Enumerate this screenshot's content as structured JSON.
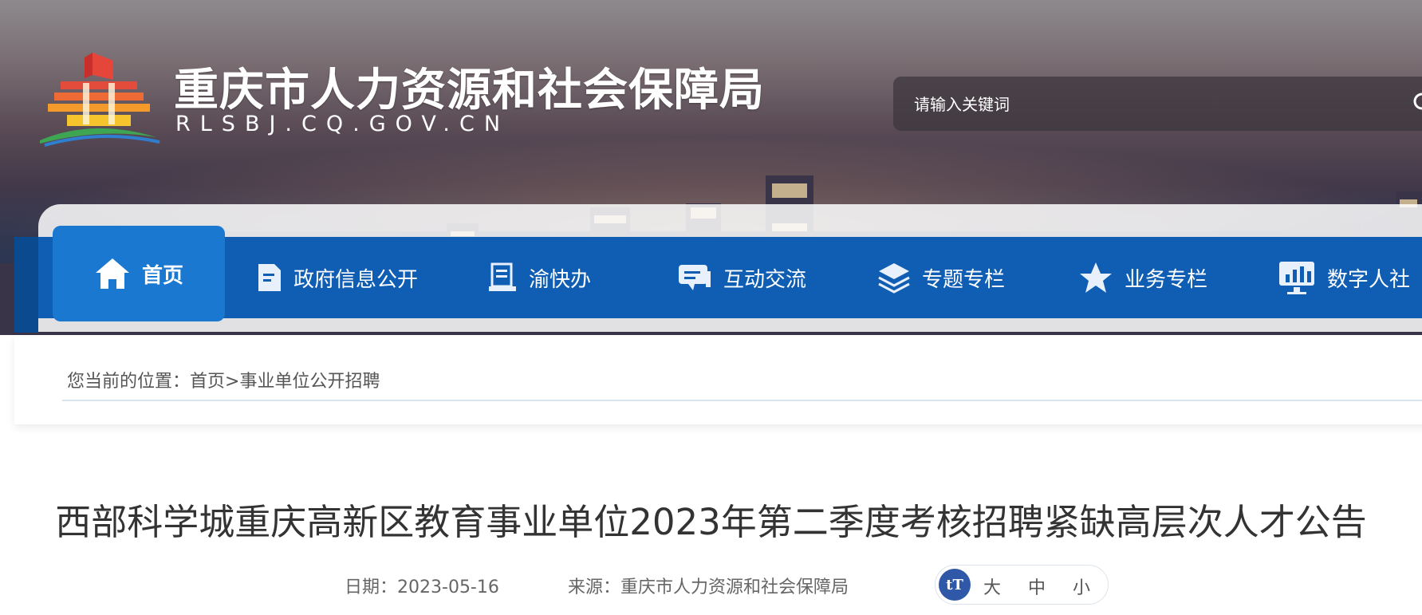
{
  "header": {
    "site_title": "重庆市人力资源和社会保障局",
    "site_domain": "RLSBJ.CQ.GOV.CN",
    "logo": "tiered-pavilion-logo",
    "search": {
      "placeholder": "请输入关键词",
      "value": "",
      "icon": "search-icon"
    }
  },
  "nav": {
    "items": [
      {
        "label": "首页",
        "icon": "home-icon",
        "active": true
      },
      {
        "label": "政府信息公开",
        "icon": "document-icon"
      },
      {
        "label": "渝快办",
        "icon": "form-icon"
      },
      {
        "label": "互动交流",
        "icon": "chat-icon"
      },
      {
        "label": "专题专栏",
        "icon": "layers-icon"
      },
      {
        "label": "业务专栏",
        "icon": "star-icon"
      },
      {
        "label": "数字人社",
        "icon": "monitor-chart-icon"
      }
    ]
  },
  "breadcrumb": {
    "prefix": "您当前的位置：",
    "home": "首页",
    "separator": ">",
    "current": "事业单位公开招聘"
  },
  "article": {
    "title": "西部科学城重庆高新区教育事业单位2023年第二季度考核招聘紧缺高层次人才公告",
    "date_label": "日期：",
    "date": "2023-05-16",
    "source_label": "来源：",
    "source": "重庆市人力资源和社会保障局",
    "font_size": {
      "icon_text": "tT",
      "large": "大",
      "medium": "中",
      "small": "小"
    }
  },
  "colors": {
    "nav_bg": "#0f5eb3",
    "nav_active_bg": "#1a78d1",
    "font_icon_bg": "#2f58a8"
  }
}
